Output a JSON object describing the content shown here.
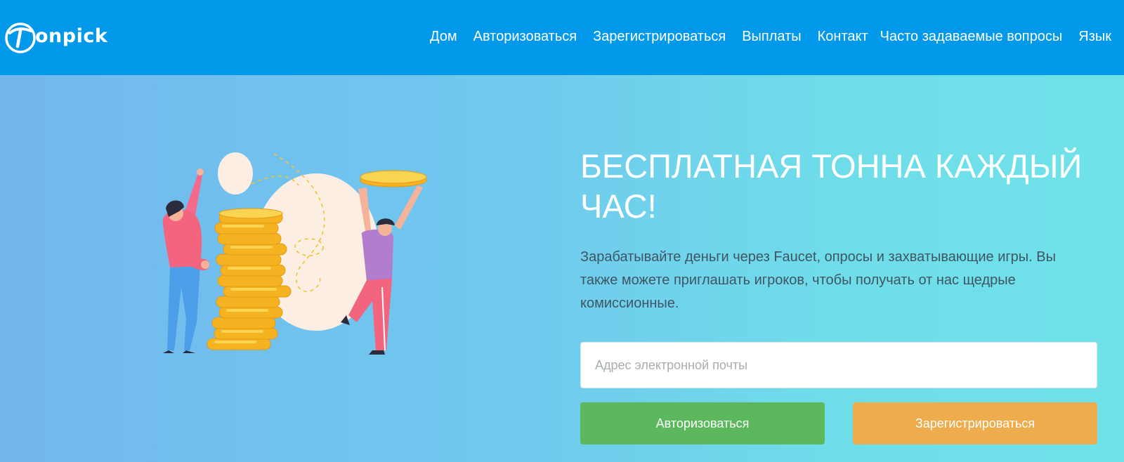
{
  "brand": {
    "name": "onpick",
    "logo_icon": "tonpick-t-logo-icon"
  },
  "nav": {
    "items": [
      {
        "label": "Дом"
      },
      {
        "label": "Авторизоваться"
      },
      {
        "label": "Зарегистрироваться"
      },
      {
        "label": "Выплаты"
      },
      {
        "label": "Контакт"
      },
      {
        "label": "Часто задаваемые вопросы"
      },
      {
        "label": "Язык"
      }
    ]
  },
  "hero": {
    "title": "БЕСПЛАТНАЯ ТОННА КАЖДЫЙ ЧАС!",
    "description": "Зарабатывайте деньги через Faucet, опросы и захватывающие игры. Вы также можете приглашать игроков, чтобы получать от нас щедрые комиссионные.",
    "illustration": "people-with-coin-stack-illustration"
  },
  "form": {
    "email_placeholder": "Адрес электронной почты",
    "email_value": "",
    "login_label": "Авторизоваться",
    "register_label": "Зарегистрироваться"
  },
  "colors": {
    "navbar": "#0299ea",
    "login_button": "#5cb85c",
    "register_button": "#eeac4c",
    "hero_text": "#3f5563"
  }
}
